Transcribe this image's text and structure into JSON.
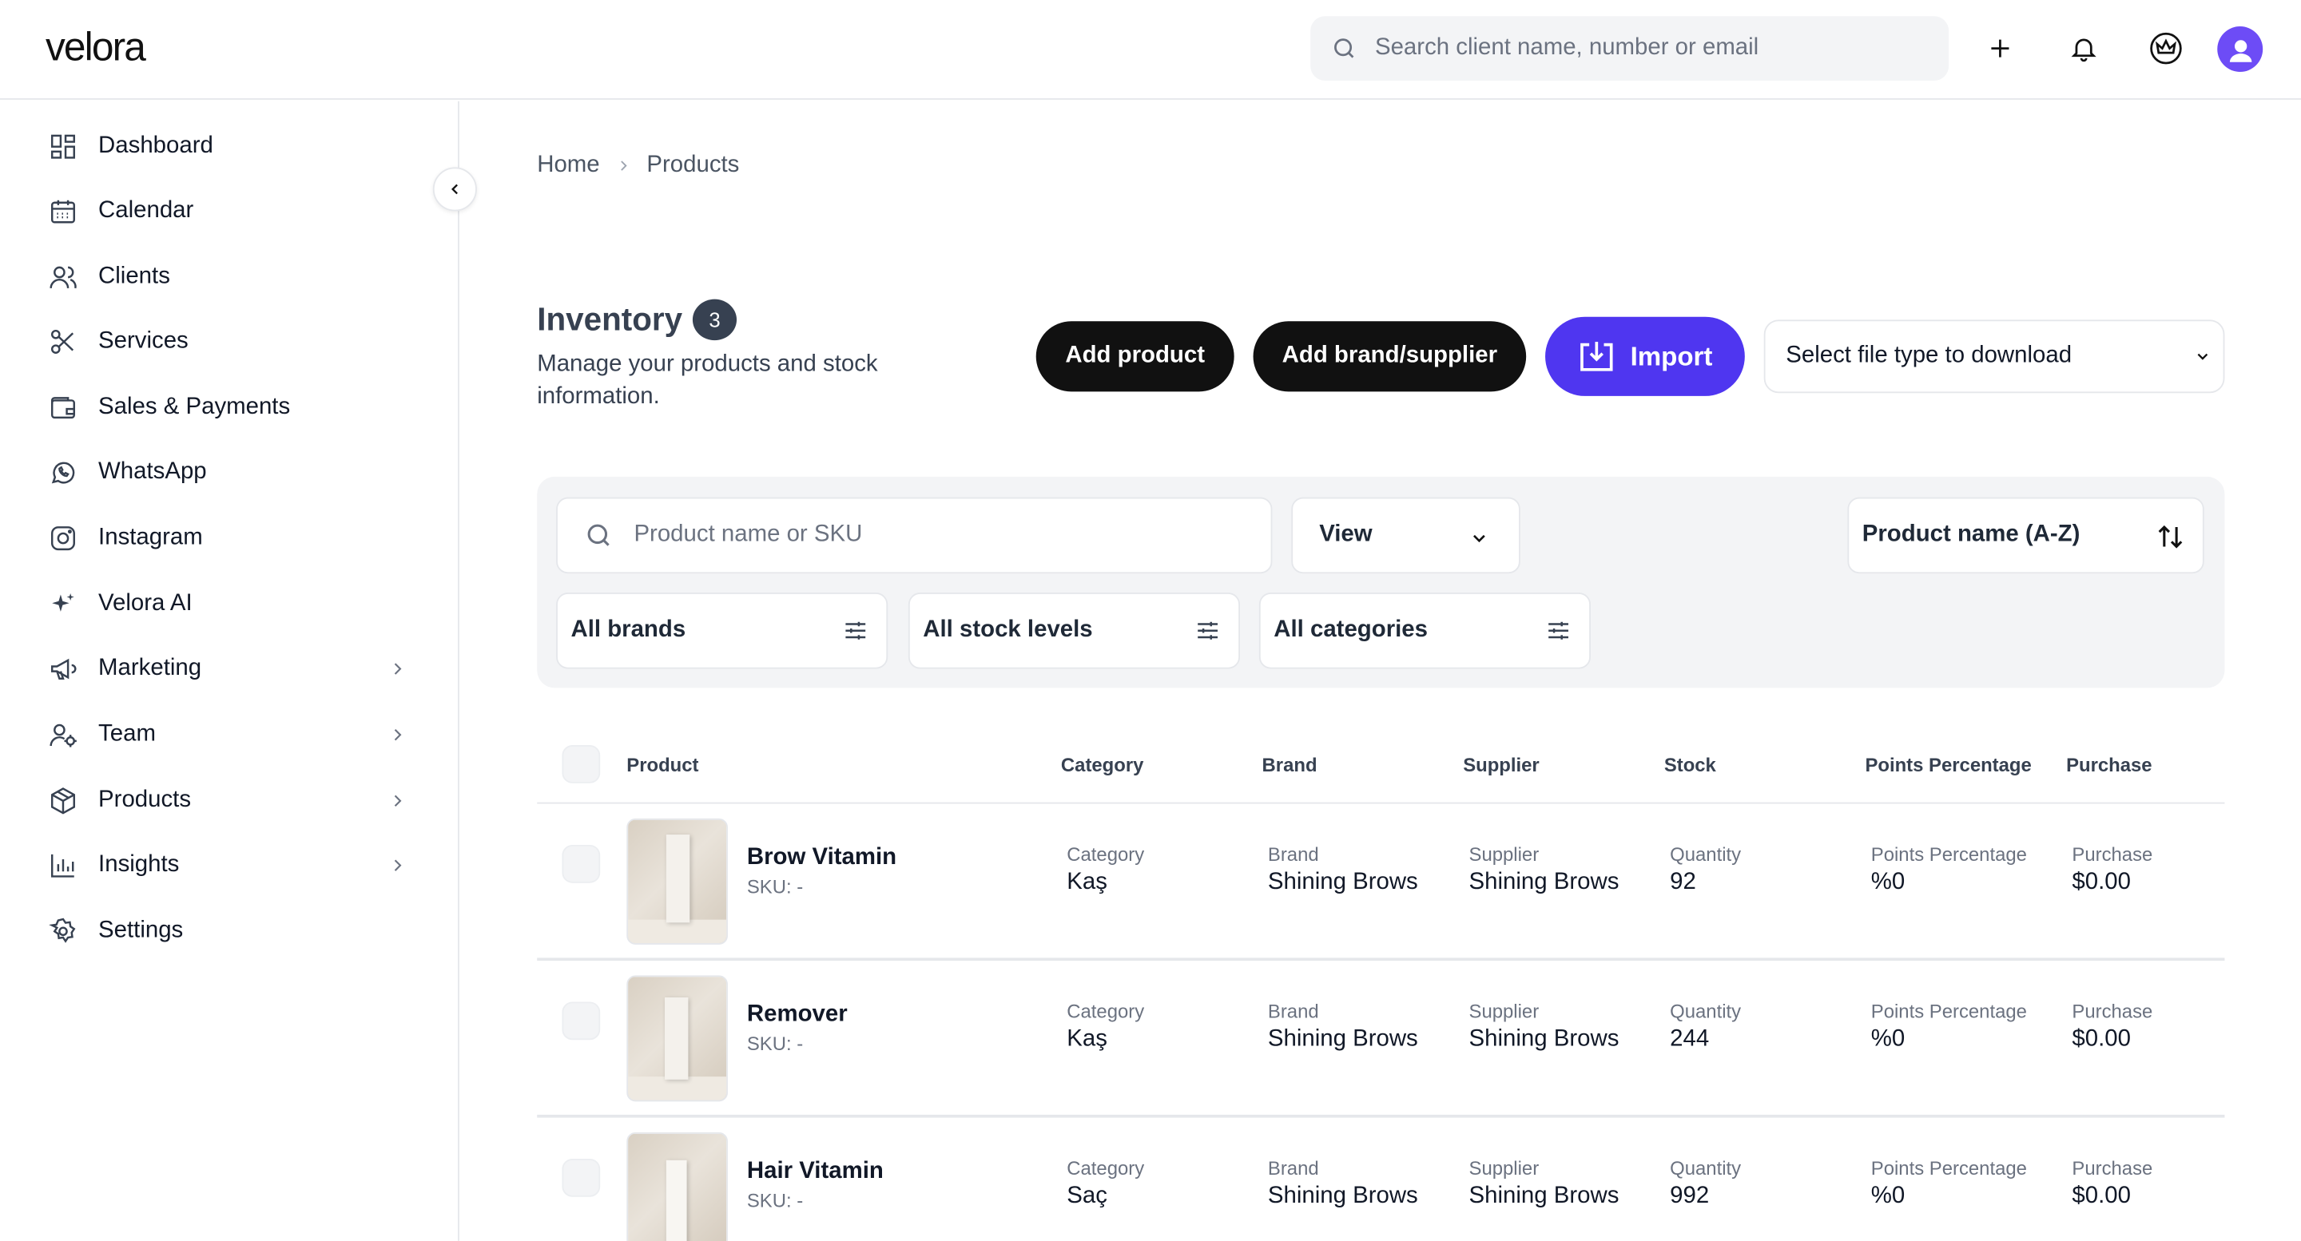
{
  "header": {
    "logo": "velora",
    "search_placeholder": "Search client name, number or email"
  },
  "sidebar": {
    "items": [
      {
        "label": "Dashboard",
        "icon": "dashboard-icon"
      },
      {
        "label": "Calendar",
        "icon": "calendar-icon"
      },
      {
        "label": "Clients",
        "icon": "users-icon"
      },
      {
        "label": "Services",
        "icon": "scissors-icon"
      },
      {
        "label": "Sales & Payments",
        "icon": "wallet-icon"
      },
      {
        "label": "WhatsApp",
        "icon": "whatsapp-icon"
      },
      {
        "label": "Instagram",
        "icon": "instagram-icon"
      },
      {
        "label": "Velora AI",
        "icon": "sparkle-icon"
      },
      {
        "label": "Marketing",
        "icon": "megaphone-icon",
        "has_submenu": true
      },
      {
        "label": "Team",
        "icon": "team-icon",
        "has_submenu": true
      },
      {
        "label": "Products",
        "icon": "box-icon",
        "has_submenu": true
      },
      {
        "label": "Insights",
        "icon": "chart-icon",
        "has_submenu": true
      },
      {
        "label": "Settings",
        "icon": "gear-icon"
      }
    ]
  },
  "breadcrumb": {
    "home": "Home",
    "current": "Products"
  },
  "inventory": {
    "title": "Inventory",
    "count": "3",
    "subtitle": "Manage your products and stock information."
  },
  "actions": {
    "add_product": "Add product",
    "add_brand": "Add brand/supplier",
    "import": "Import",
    "file_type_select": "Select file type to download"
  },
  "filters": {
    "search_placeholder": "Product name or SKU",
    "view": "View",
    "sort": "Product name (A-Z)",
    "brands": "All brands",
    "stock": "All stock levels",
    "categories": "All categories"
  },
  "table": {
    "columns": [
      "Product",
      "Category",
      "Brand",
      "Supplier",
      "Stock",
      "Points Percentage",
      "Purchase"
    ],
    "cell_labels": {
      "category": "Category",
      "brand": "Brand",
      "supplier": "Supplier",
      "quantity": "Quantity",
      "points": "Points Percentage",
      "purchase": "Purchase"
    },
    "rows": [
      {
        "name": "Brow Vitamin",
        "sku": "SKU: -",
        "category": "Kaş",
        "brand": "Shining Brows",
        "supplier": "Shining Brows",
        "quantity": "92",
        "points": "%0",
        "purchase": "$0.00"
      },
      {
        "name": "Remover",
        "sku": "SKU: -",
        "category": "Kaş",
        "brand": "Shining Brows",
        "supplier": "Shining Brows",
        "quantity": "244",
        "points": "%0",
        "purchase": "$0.00"
      },
      {
        "name": "Hair Vitamin",
        "sku": "SKU: -",
        "category": "Saç",
        "brand": "Shining Brows",
        "supplier": "Shining Brows",
        "quantity": "992",
        "points": "%0",
        "purchase": "$0.00"
      }
    ]
  },
  "colors": {
    "accent": "#4f36f0",
    "dark_button": "#111111",
    "avatar": "#6d4cf6"
  }
}
